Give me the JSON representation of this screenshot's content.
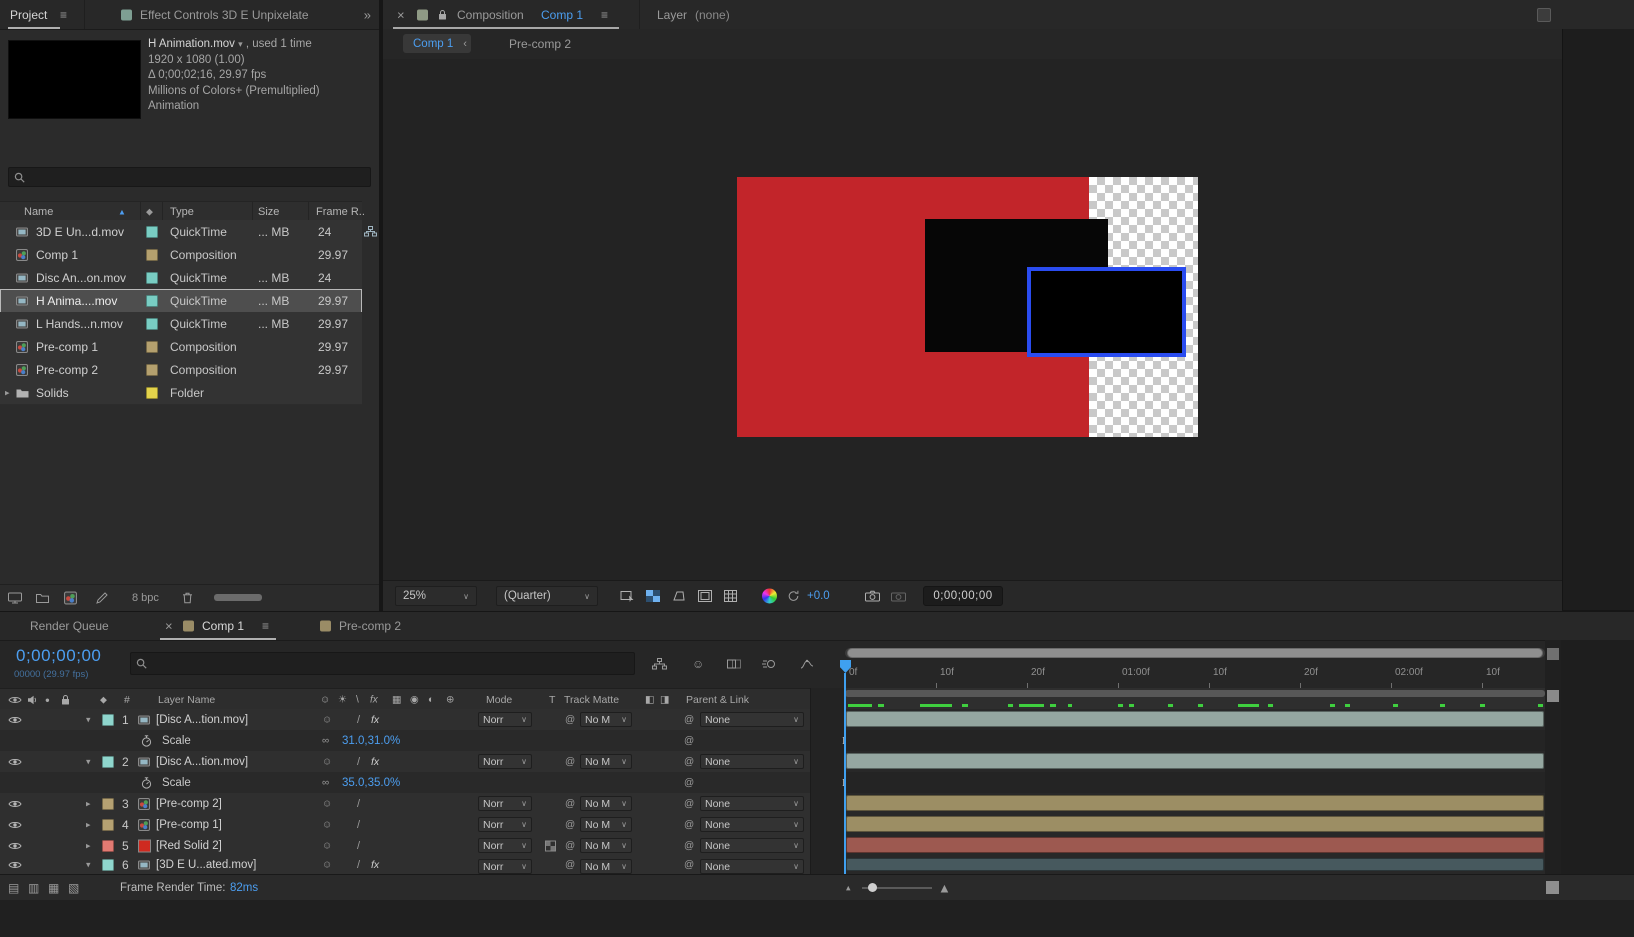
{
  "glyphs": {
    "menu": "≡",
    "close": "×",
    "overflow": "»",
    "dropdown": "∨",
    "caret_info": "▾",
    "chev_left": "‹",
    "sort_asc": "▲",
    "tag": "◆",
    "solo": "●",
    "whip": "@",
    "link": "∞",
    "keyframe": "I",
    "shy": "☺",
    "mode_icon_a": "◧",
    "mode_icon_b": "◨",
    "mtn_small": "▴",
    "mtn_large": "▲"
  },
  "project": {
    "tab": "Project",
    "tab2": "Effect Controls 3D E Unpixelate",
    "info": {
      "name": "H Animation.mov",
      "usage": ", used 1 time",
      "dims": "1920 x 1080 (1.00)",
      "duration": "Δ 0;00;02;16, 29.97 fps",
      "colors": "Millions of Colors+ (Premultiplied)",
      "codec": "Animation"
    },
    "columns": {
      "name": "Name",
      "type": "Type",
      "size": "Size",
      "framerate": "Frame R.."
    },
    "rows": [
      {
        "name": "3D E Un...d.mov",
        "type": "QuickTime",
        "size": "... MB",
        "fps": "24",
        "chip": "#79cdc3"
      },
      {
        "name": "Comp 1",
        "type": "Composition",
        "size": "",
        "fps": "29.97",
        "chip": "#b4a06e"
      },
      {
        "name": "Disc An...on.mov",
        "type": "QuickTime",
        "size": "... MB",
        "fps": "24",
        "chip": "#79cdc3"
      },
      {
        "name": "H Anima....mov",
        "type": "QuickTime",
        "size": "... MB",
        "fps": "29.97",
        "chip": "#79cdc3"
      },
      {
        "name": "L Hands...n.mov",
        "type": "QuickTime",
        "size": "... MB",
        "fps": "29.97",
        "chip": "#79cdc3"
      },
      {
        "name": "Pre-comp 1",
        "type": "Composition",
        "size": "",
        "fps": "29.97",
        "chip": "#b4a06e"
      },
      {
        "name": "Pre-comp 2",
        "type": "Composition",
        "size": "",
        "fps": "29.97",
        "chip": "#b4a06e"
      },
      {
        "name": "Solids",
        "type": "Folder",
        "size": "",
        "fps": "",
        "chip": "#e3d34b",
        "expander": "▸"
      }
    ],
    "footer_bit_depth": "8 bpc"
  },
  "viewer": {
    "panel_label": "Composition",
    "comp_name": "Comp 1",
    "layer_label": "Layer",
    "layer_value": "(none)",
    "breadcrumb_current": "Comp 1",
    "breadcrumb_parent": "Pre-comp 2",
    "zoom": "25%",
    "resolution": "(Quarter)",
    "exposure": "+0.0",
    "timecode": "0;00;00;00",
    "colors": {
      "red": "#c2252a",
      "selection_blue": "#2a4cf0"
    }
  },
  "timeline": {
    "render_queue_tab": "Render Queue",
    "tab": "Comp 1",
    "tab2": "Pre-comp 2",
    "current_time": "0;00;00;00",
    "frame_info": "00000 (29.97 fps)",
    "columns": {
      "index": "#",
      "layer_name": "Layer Name",
      "mode": "Mode",
      "t": "T",
      "track_matte": "Track Matte",
      "parent": "Parent & Link"
    },
    "switch_icons": [
      "☺",
      "☀",
      "\\",
      "fx",
      "▦",
      "◉",
      "◐",
      "⊕"
    ],
    "pane_icons": [
      "▤",
      "▥",
      "▦",
      "▧"
    ],
    "layers": [
      {
        "index": "1",
        "caret": "▾",
        "chip": "#8fd6cd",
        "kind": "footage",
        "name": "[Disc A...tion.mov]",
        "quality": "/",
        "fx": "fx",
        "mode": "Norr",
        "matte": "No M",
        "parent": "None",
        "bar": "#95a7a1",
        "prop_label": "Scale",
        "prop_value": "31.0,31.0%"
      },
      {
        "index": "2",
        "caret": "▾",
        "chip": "#8fd6cd",
        "kind": "footage",
        "name": "[Disc A...tion.mov]",
        "quality": "/",
        "fx": "fx",
        "mode": "Norr",
        "matte": "No M",
        "parent": "None",
        "bar": "#95a7a1",
        "prop_label": "Scale",
        "prop_value": "35.0,35.0%"
      },
      {
        "index": "3",
        "caret": "▸",
        "chip": "#b5a172",
        "kind": "comp",
        "name": "[Pre-comp 2]",
        "quality": "/",
        "fx": "",
        "mode": "Norr",
        "matte": "No M",
        "parent": "None",
        "bar": "#9c8e64"
      },
      {
        "index": "4",
        "caret": "▸",
        "chip": "#b5a172",
        "kind": "comp",
        "name": "[Pre-comp 1]",
        "quality": "/",
        "fx": "",
        "mode": "Norr",
        "matte": "No M",
        "parent": "None",
        "bar": "#9c8e64"
      },
      {
        "index": "5",
        "caret": "▸",
        "chip": "#e27a72",
        "kind": "solid",
        "name": "[Red Solid 2]",
        "quality": "/",
        "fx": "",
        "mode": "Norr",
        "matte": "No M",
        "parent": "None",
        "bar": "#9d5950",
        "solid_color": "#cf2a20"
      },
      {
        "index": "6",
        "caret": "▾",
        "chip": "#8fd6cd",
        "kind": "footage",
        "name": "[3D E U...ated.mov]",
        "quality": "/",
        "fx": "fx",
        "mode": "Norr",
        "matte": "No M",
        "parent": "None",
        "bar": "#47595e"
      }
    ],
    "ruler": [
      "0f",
      "10f",
      "20f",
      "01:00f",
      "10f",
      "20f",
      "02:00f",
      "10f"
    ],
    "cache_color": "#3fcf3f",
    "cache_segments": [
      [
        0.4,
        3.4
      ],
      [
        4.7,
        0.9
      ],
      [
        10.7,
        4.6
      ],
      [
        16.7,
        0.9
      ],
      [
        23.3,
        0.7
      ],
      [
        24.9,
        3.6
      ],
      [
        29.3,
        0.9
      ],
      [
        31.9,
        0.6
      ],
      [
        39,
        0.7
      ],
      [
        40.6,
        0.7
      ],
      [
        46.1,
        0.7
      ],
      [
        50.4,
        0.7
      ],
      [
        56.1,
        3.1
      ],
      [
        60.4,
        0.7
      ],
      [
        69.3,
        0.7
      ],
      [
        71.4,
        0.7
      ],
      [
        78.3,
        0.7
      ],
      [
        85,
        0.7
      ],
      [
        90.7,
        0.7
      ],
      [
        99,
        0.7
      ]
    ],
    "status_label": "Frame Render Time:",
    "status_value": "82ms"
  }
}
